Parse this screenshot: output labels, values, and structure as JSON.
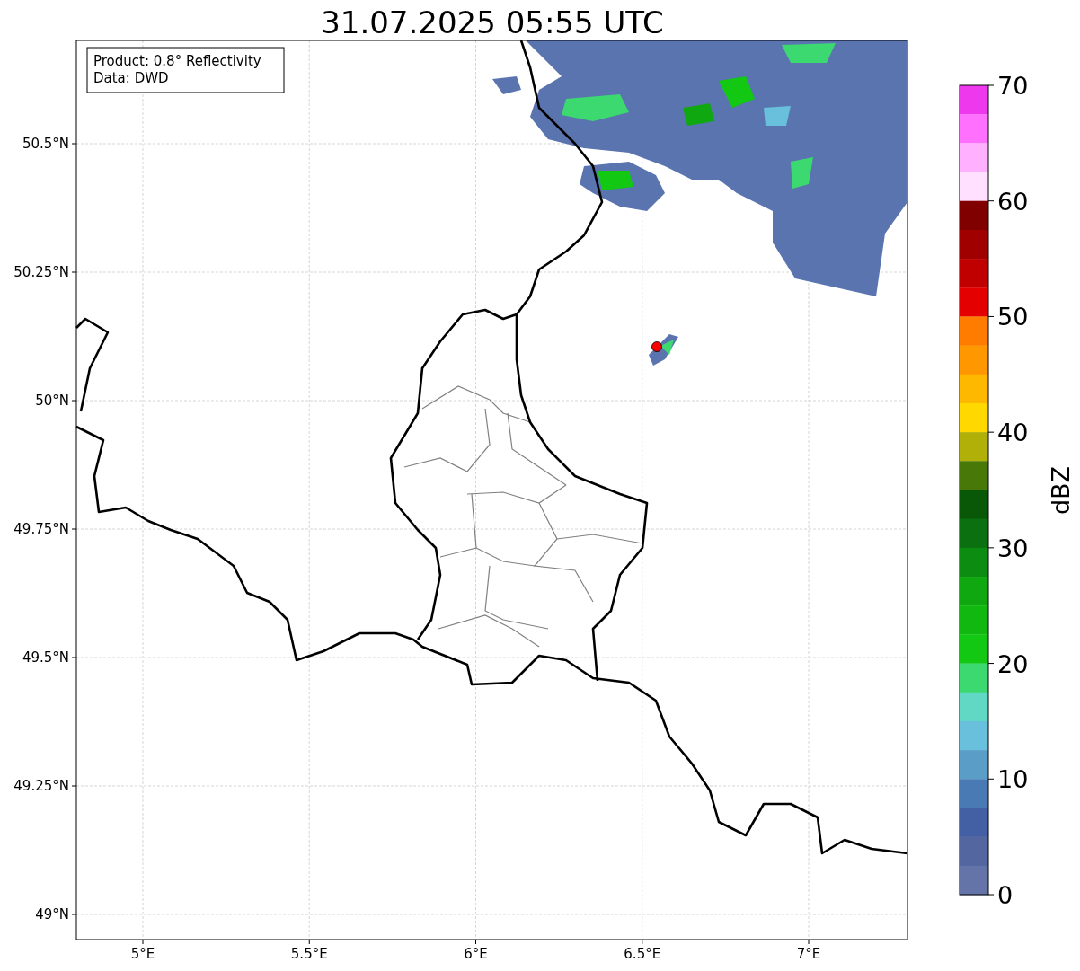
{
  "title": "31.07.2025 05:55 UTC",
  "info_box": [
    "Product: 0.8° Reflectivity",
    "Data: DWD"
  ],
  "map": {
    "lat_labels": [
      "50.5°N",
      "50.25°N",
      "50°N",
      "49.75°N",
      "49.5°N",
      "49.25°N",
      "49°N"
    ],
    "lon_labels": [
      "5°E",
      "5.5°E",
      "6°E",
      "6.5°E",
      "7°E"
    ]
  },
  "colorbar": {
    "label": "dBZ",
    "ticks": [
      "70",
      "60",
      "50",
      "40",
      "30",
      "20",
      "10",
      "0"
    ],
    "bins": [
      {
        "color": "#ee38ee"
      },
      {
        "color": "#ff70ff"
      },
      {
        "color": "#ffb0ff"
      },
      {
        "color": "#ffe0ff"
      },
      {
        "color": "#800000"
      },
      {
        "color": "#a00000"
      },
      {
        "color": "#c00000"
      },
      {
        "color": "#e40000"
      },
      {
        "color": "#ff7c00"
      },
      {
        "color": "#ff9800"
      },
      {
        "color": "#ffb800"
      },
      {
        "color": "#ffd800"
      },
      {
        "color": "#b0b008"
      },
      {
        "color": "#487808"
      },
      {
        "color": "#085808"
      },
      {
        "color": "#0a7010"
      },
      {
        "color": "#0c8c10"
      },
      {
        "color": "#10a810"
      },
      {
        "color": "#10b810"
      },
      {
        "color": "#12c812"
      },
      {
        "color": "#3cd870"
      },
      {
        "color": "#60d8c4"
      },
      {
        "color": "#68c0dc"
      },
      {
        "color": "#5a9ec8"
      },
      {
        "color": "#4a7ab4"
      },
      {
        "color": "#4460a4"
      },
      {
        "color": "#5466a0"
      },
      {
        "color": "#6474a8"
      }
    ]
  }
}
